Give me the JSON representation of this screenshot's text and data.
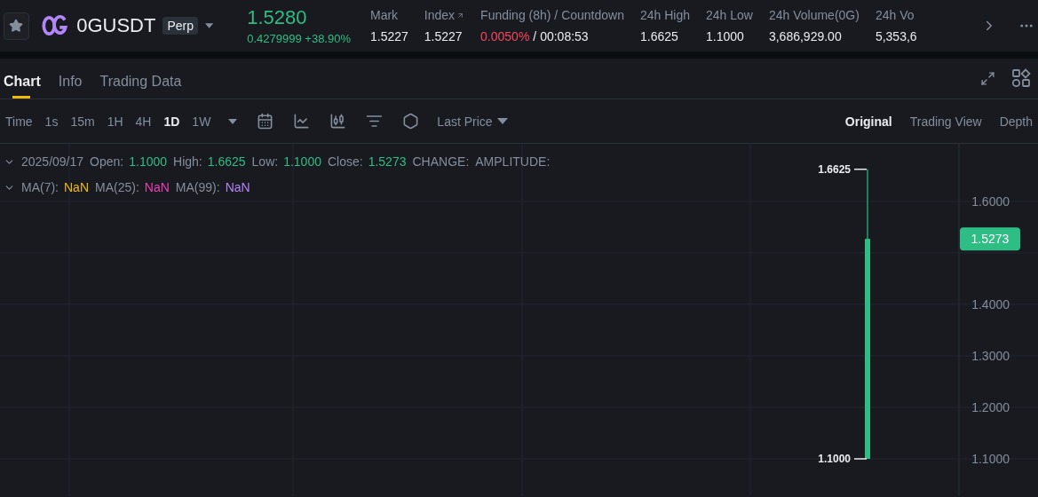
{
  "ticker": {
    "symbol": "0GUSDT",
    "badge": "Perp",
    "favorite": false,
    "price": "1.5280",
    "change": "0.4279999 +38.90%"
  },
  "stats": [
    {
      "kind": "plain",
      "label": "Mark",
      "value": "1.5227"
    },
    {
      "kind": "link",
      "label": "Index",
      "value": "1.5227"
    },
    {
      "kind": "funding",
      "label": "Funding (8h) / Countdown",
      "rate": "0.0050%",
      "value": "/ 00:08:53"
    },
    {
      "kind": "plain",
      "label": "24h High",
      "value": "1.6625"
    },
    {
      "kind": "plain",
      "label": "24h Low",
      "value": "1.1000"
    },
    {
      "kind": "plain",
      "label": "24h Volume(0G)",
      "value": "3,686,929.00"
    },
    {
      "kind": "plain",
      "label": "24h Vo",
      "value": "5,353,6"
    }
  ],
  "tabs": [
    {
      "label": "Chart",
      "selected": true
    },
    {
      "label": "Info",
      "selected": false
    },
    {
      "label": "Trading Data",
      "selected": false
    }
  ],
  "toolbar": {
    "intervals": [
      {
        "label": "Time",
        "selected": false
      },
      {
        "label": "1s",
        "selected": false
      },
      {
        "label": "15m",
        "selected": false
      },
      {
        "label": "1H",
        "selected": false
      },
      {
        "label": "4H",
        "selected": false
      },
      {
        "label": "1D",
        "selected": true
      },
      {
        "label": "1W",
        "selected": false
      }
    ],
    "price_type": "Last Price",
    "views": [
      {
        "label": "Original",
        "selected": true
      },
      {
        "label": "Trading View",
        "selected": false
      },
      {
        "label": "Depth",
        "selected": false
      }
    ]
  },
  "legend": {
    "date": "2025/09/17",
    "ohlc": [
      {
        "label": "Open:",
        "value": "1.1000"
      },
      {
        "label": "High:",
        "value": "1.6625"
      },
      {
        "label": "Low:",
        "value": "1.1000"
      },
      {
        "label": "Close:",
        "value": "1.5273"
      },
      {
        "label": "CHANGE:"
      },
      {
        "label": "AMPLITUDE:"
      }
    ],
    "ma": [
      {
        "label": "MA(7):",
        "value": "NaN",
        "color": "#f0b90b"
      },
      {
        "label": "MA(25):",
        "value": "NaN",
        "color": "#eb40b5"
      },
      {
        "label": "MA(99):",
        "value": "NaN",
        "color": "#b385f8"
      }
    ]
  },
  "chart_data": {
    "type": "bar",
    "categories": [
      null
    ],
    "ylim": [
      1.0276,
      1.712
    ],
    "yticks": [
      {
        "value": 1.6,
        "label": "1.6000"
      },
      {
        "value": 1.4,
        "label": "1.4000"
      },
      {
        "value": 1.3,
        "label": "1.3000"
      },
      {
        "value": 1.2,
        "label": "1.2000"
      },
      {
        "value": 1.1,
        "label": "1.1000"
      }
    ],
    "grid": true,
    "annotations": [
      "1.6625",
      "1.1000",
      "1.5273"
    ]
  }
}
